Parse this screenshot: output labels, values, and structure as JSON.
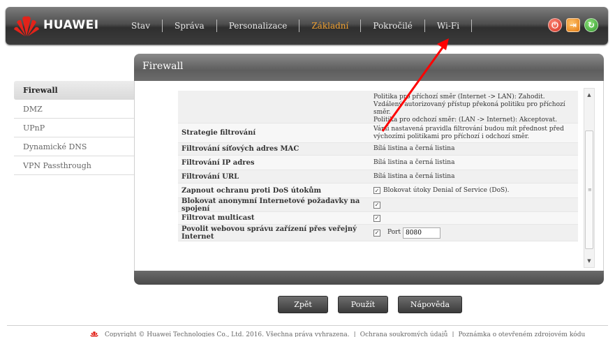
{
  "header": {
    "brand": "HUAWEI",
    "nav": [
      {
        "label": "Stav",
        "active": false
      },
      {
        "label": "Správa",
        "active": false
      },
      {
        "label": "Personalizace",
        "active": false
      },
      {
        "label": "Základní",
        "active": true
      },
      {
        "label": "Pokročilé",
        "active": false
      },
      {
        "label": "Wi-Fi",
        "active": false
      }
    ],
    "icons": [
      "power-icon",
      "logout-icon",
      "refresh-icon"
    ],
    "active_color": "#f0a030"
  },
  "sidebar": {
    "items": [
      {
        "label": "Firewall",
        "active": true
      },
      {
        "label": "DMZ",
        "active": false
      },
      {
        "label": "UPnP",
        "active": false
      },
      {
        "label": "Dynamické DNS",
        "active": false
      },
      {
        "label": "VPN Passthrough",
        "active": false
      }
    ]
  },
  "panel": {
    "title": "Firewall",
    "rows": [
      {
        "label": "",
        "lines": [
          "Politika pro příchozí směr (Internet -> LAN): Zahodit.",
          "Vzdálený autorizovaný přístup překoná politiku pro příchozí směr.",
          "Politika pro odchozí směr: (LAN -> Internet): Akceptovat."
        ]
      },
      {
        "label": "Strategie filtrování",
        "lines": [
          "Vámi nastavená pravidla filtrování budou mít přednost před výchozími politikami pro příchozí i odchozí směr."
        ]
      },
      {
        "label": "Filtrování síťových adres MAC",
        "lines": [
          "Bílá listina a černá listina"
        ]
      },
      {
        "label": "Filtrování IP adres",
        "lines": [
          "Bílá listina a černá listina"
        ]
      },
      {
        "label": "Filtrování URL",
        "lines": [
          "Bílá listina a černá listina"
        ]
      },
      {
        "label": "Zapnout ochranu proti DoS útokům",
        "checkbox": true,
        "checkbox_label": "Blokovat útoky Denial of Service (DoS)."
      },
      {
        "label": "Blokovat anonymní Internetové požadavky na spojení",
        "checkbox": true
      },
      {
        "label": "Filtrovat multicast",
        "checkbox": true
      },
      {
        "label": "Povolit webovou správu zařízení přes veřejný Internet",
        "checkbox": true,
        "port_label": "Port",
        "port_value": "8080"
      }
    ]
  },
  "buttons": {
    "back": "Zpět",
    "apply": "Použít",
    "help": "Nápověda"
  },
  "footer": {
    "copyright": "Copyright © Huawei Technologies Co., Ltd. 2016. Všechna práva vyhrazena.",
    "privacy": "Ochrana soukromých údajů",
    "opensource": "Poznámka o otevřeném zdrojovém kódu"
  },
  "colors": {
    "annotation_arrow": "#ff0000",
    "brand_red": "#e2231a"
  }
}
